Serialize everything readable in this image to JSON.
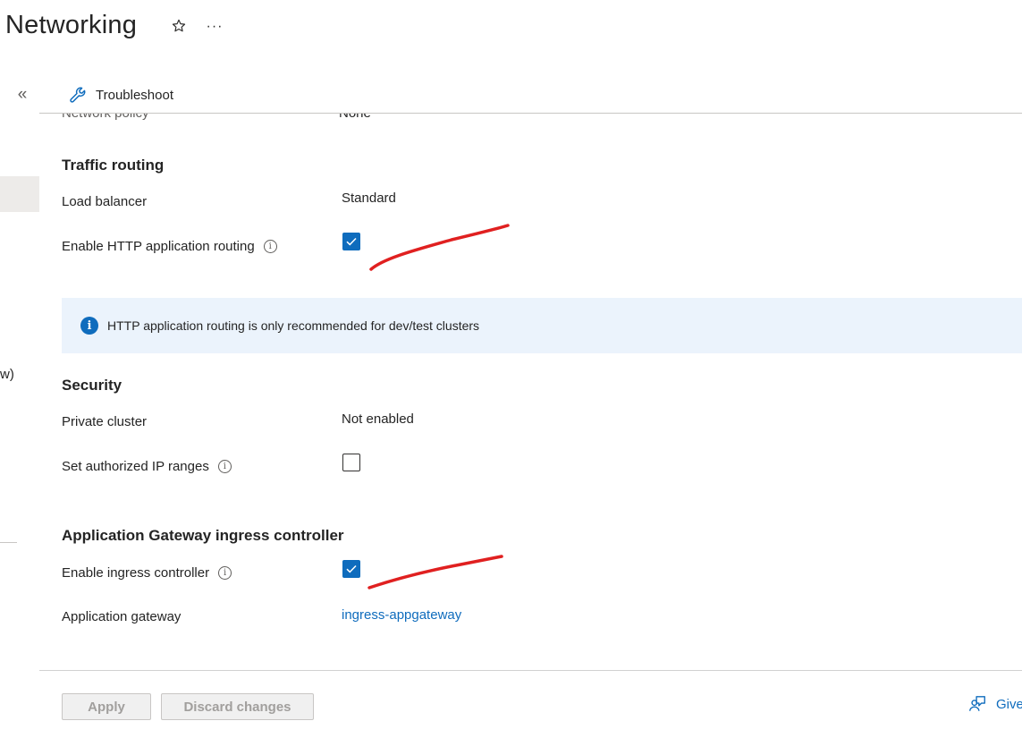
{
  "header": {
    "title": "Networking",
    "favorite_icon": "star-outline-icon",
    "more_label": "···"
  },
  "sidebar": {
    "collapse_label": "«",
    "cut_off_text": "w)"
  },
  "toolbar": {
    "troubleshoot_label": "Troubleshoot",
    "troubleshoot_icon": "wrench-icon"
  },
  "partial_row": {
    "label": "Network policy",
    "value": "None"
  },
  "traffic_routing": {
    "heading": "Traffic routing",
    "load_balancer_label": "Load balancer",
    "load_balancer_value": "Standard",
    "http_routing_label": "Enable HTTP application routing",
    "http_routing_checked": true
  },
  "info_banner": {
    "text": "HTTP application routing is only recommended for dev/test clusters",
    "icon": "info-filled-icon"
  },
  "security": {
    "heading": "Security",
    "private_cluster_label": "Private cluster",
    "private_cluster_value": "Not enabled",
    "authorized_ip_label": "Set authorized IP ranges",
    "authorized_ip_checked": false
  },
  "app_gateway": {
    "heading": "Application Gateway ingress controller",
    "ingress_label": "Enable ingress controller",
    "ingress_checked": true,
    "gateway_label": "Application gateway",
    "gateway_link": "ingress-appgateway"
  },
  "footer": {
    "apply_label": "Apply",
    "discard_label": "Discard changes",
    "feedback_label": "Give"
  },
  "colors": {
    "accent": "#0f6cbd",
    "annotation": "#e02020",
    "banner_bg": "#ebf3fc"
  }
}
